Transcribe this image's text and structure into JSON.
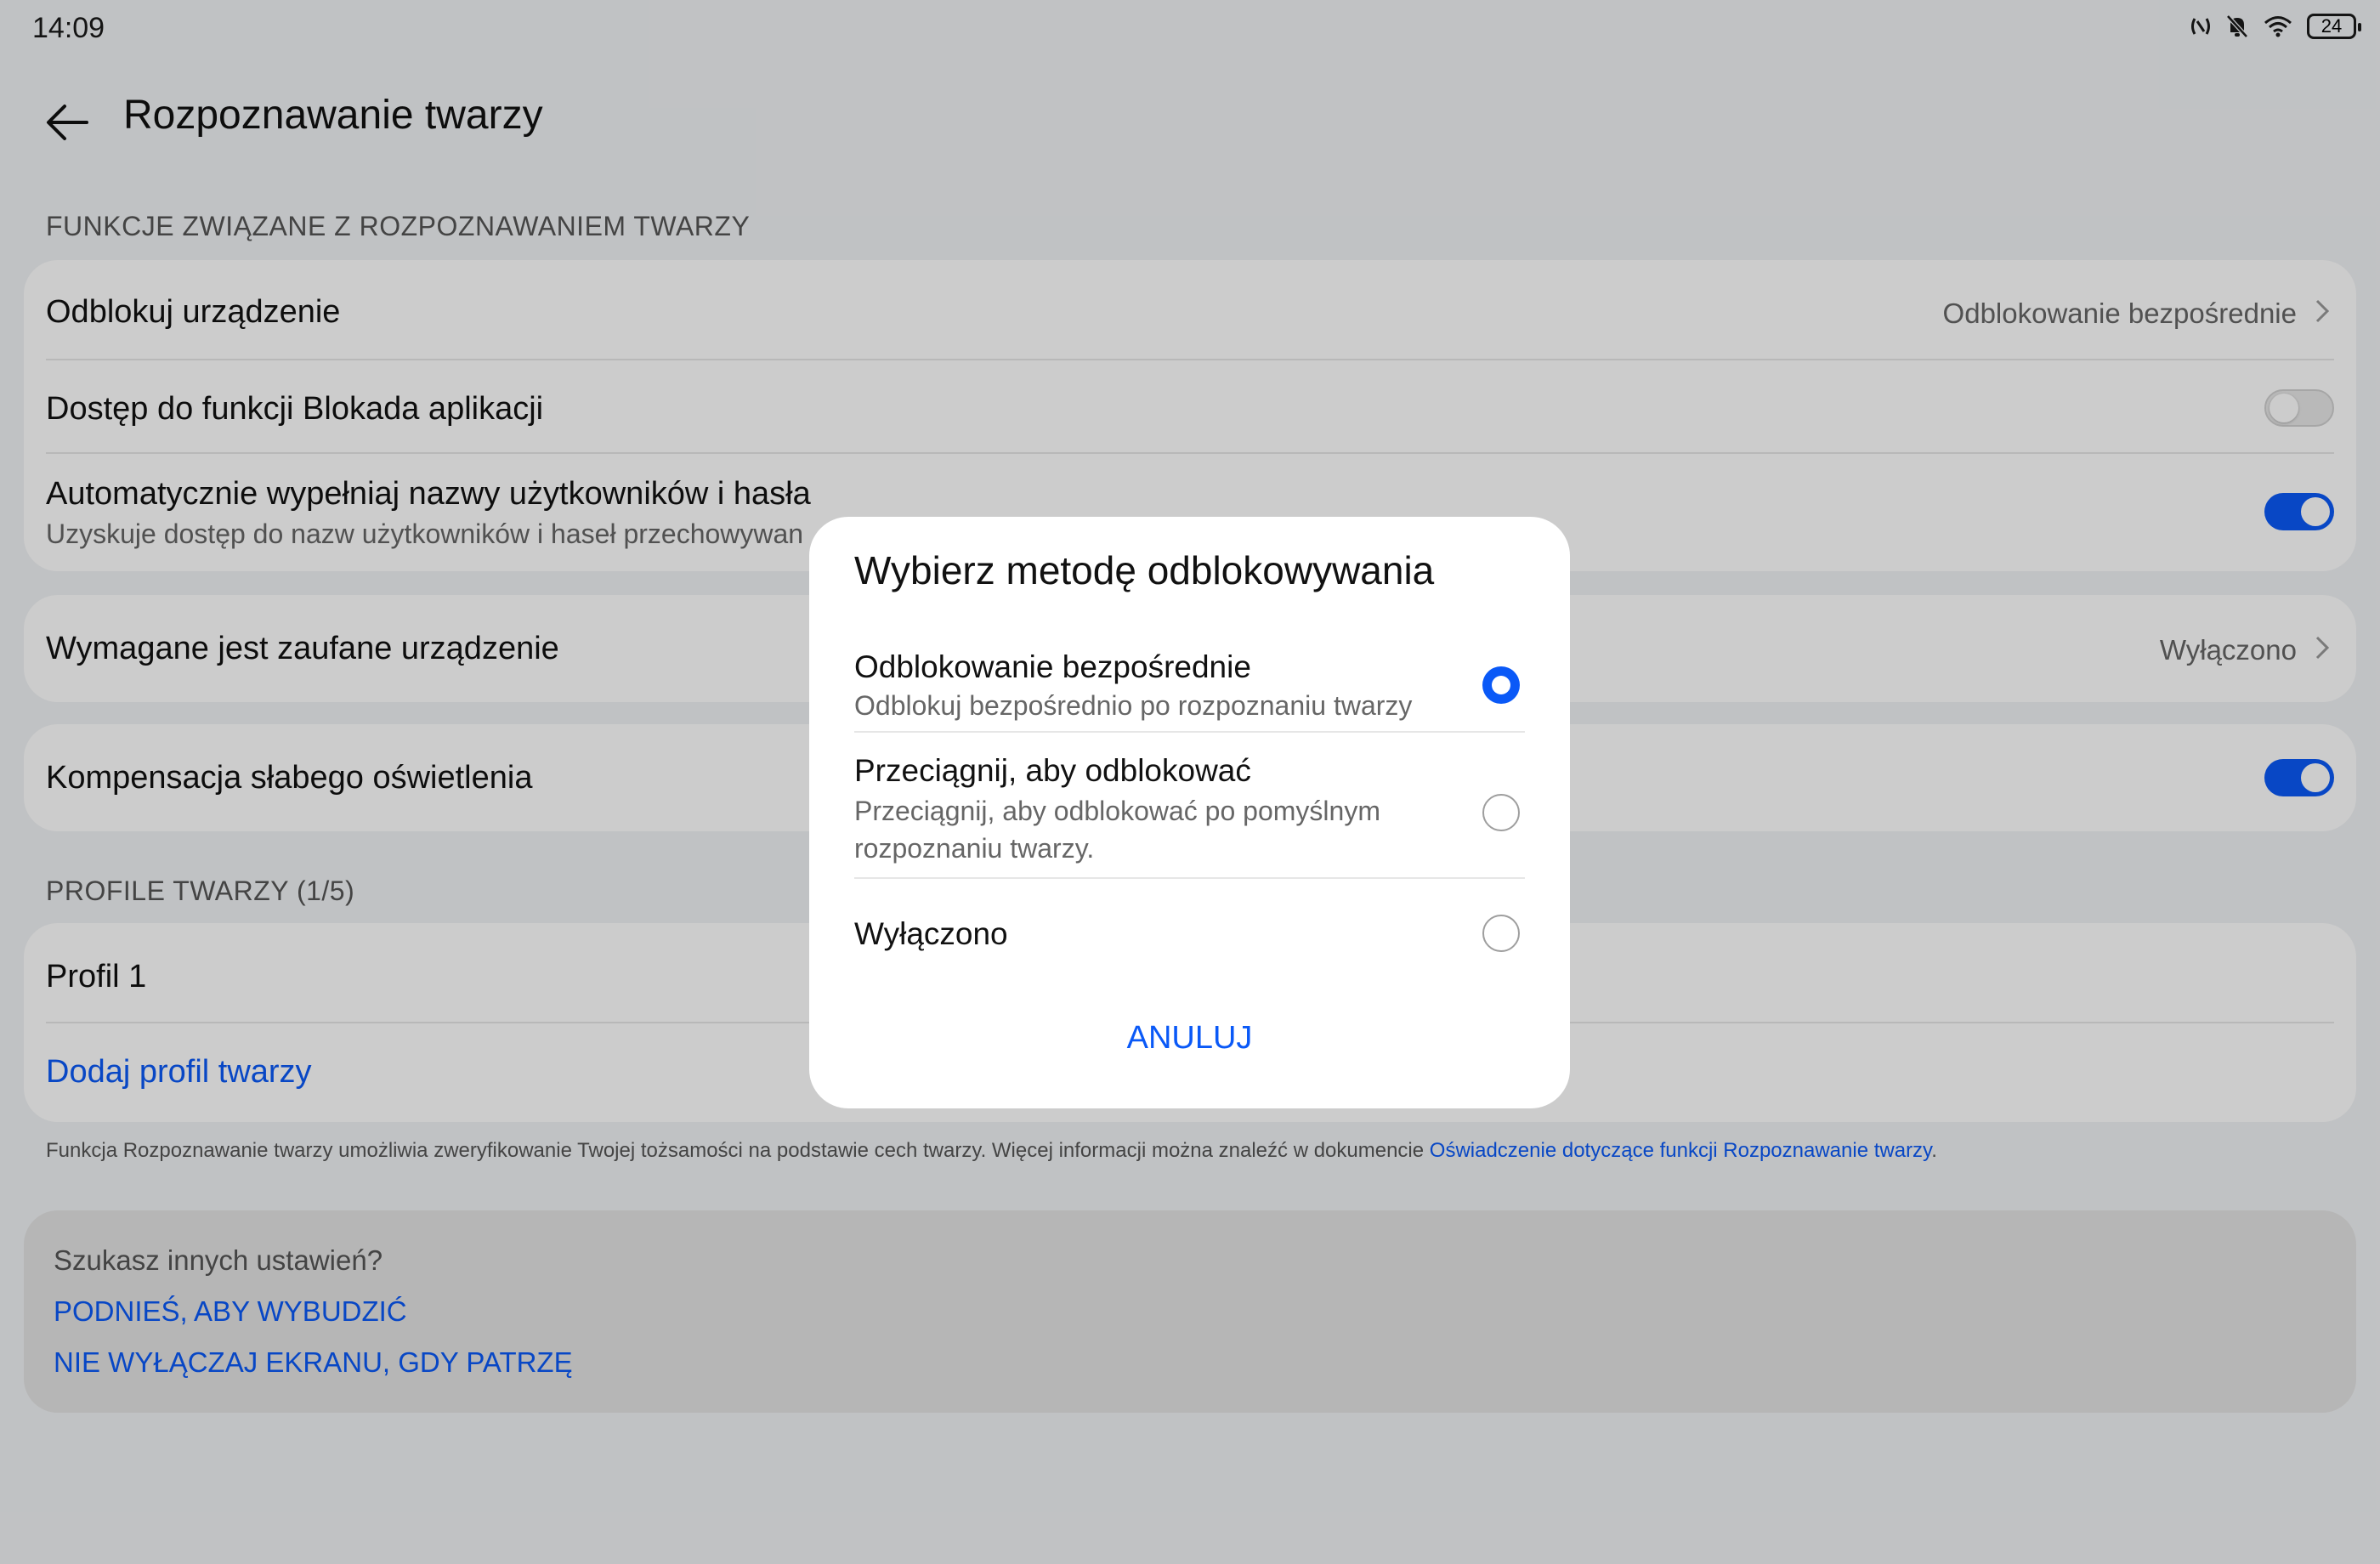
{
  "status_bar": {
    "time": "14:09",
    "battery": "24"
  },
  "header": {
    "title": "Rozpoznawanie twarzy"
  },
  "section_features": {
    "label": "FUNKCJE ZWIĄZANE Z ROZPOZNAWANIEM TWARZY"
  },
  "unlock_device": {
    "title": "Odblokuj urządzenie",
    "value": "Odblokowanie bezpośrednie"
  },
  "app_lock": {
    "title": "Dostęp do funkcji Blokada aplikacji",
    "enabled": false
  },
  "autofill": {
    "title": "Automatycznie wypełniaj nazwy użytkowników i hasła",
    "subtitle": "Uzyskuje dostęp do nazw użytkowników i haseł przechowywan",
    "enabled": true
  },
  "trusted_device": {
    "title": "Wymagane jest zaufane urządzenie",
    "value": "Wyłączono"
  },
  "low_light": {
    "title": "Kompensacja słabego oświetlenia",
    "enabled": true
  },
  "section_profiles": {
    "label": "PROFILE TWARZY (1/5)"
  },
  "profiles": {
    "profile1": "Profil 1",
    "add": "Dodaj profil twarzy"
  },
  "footnote": {
    "text": "Funkcja Rozpoznawanie twarzy umożliwia zweryfikowanie Twojej tożsamości na podstawie cech twarzy. Więcej informacji można znaleźć w dokumencie ",
    "link": "Oświadczenie dotyczące funkcji Rozpoznawanie twarzy",
    "end": "."
  },
  "other_settings": {
    "title": "Szukasz innych ustawień?",
    "links": [
      "PODNIEŚ, ABY WYBUDZIĆ",
      "NIE WYŁĄCZAJ EKRANU, GDY PATRZĘ"
    ]
  },
  "dialog": {
    "title": "Wybierz metodę odblokowywania",
    "options": [
      {
        "title": "Odblokowanie bezpośrednie",
        "subtitle": "Odblokuj bezpośrednio po rozpoznaniu twarzy",
        "selected": true
      },
      {
        "title": "Przeciągnij, aby odblokować",
        "subtitle": "Przeciągnij, aby odblokować po pomyślnym rozpoznaniu twarzy.",
        "selected": false
      },
      {
        "title": "Wyłączono",
        "subtitle": "",
        "selected": false
      }
    ],
    "cancel": "ANULUJ"
  },
  "colors": {
    "accent": "#0a59f7",
    "background": "#f1f3f5",
    "card": "#ffffff"
  }
}
